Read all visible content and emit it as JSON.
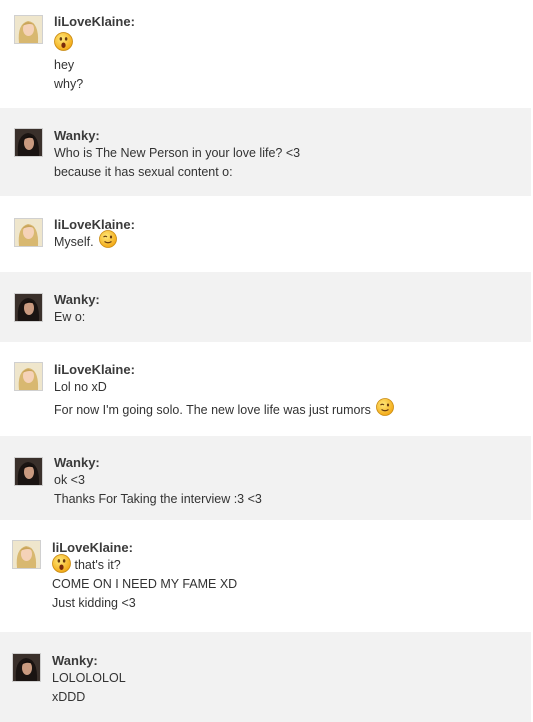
{
  "users": {
    "a": {
      "name": "liLoveKlaine:",
      "avatar_icon": "blonde-avatar-icon"
    },
    "b": {
      "name": "Wanky:",
      "avatar_icon": "dark-hair-avatar-icon"
    }
  },
  "colors": {
    "alt_background": "#f2f2f2",
    "text": "#333333"
  },
  "messages": [
    {
      "author": "liLoveKlaine:",
      "lines": [
        "",
        "hey",
        "why?"
      ],
      "emoji": [
        "shocked-emoji-icon"
      ]
    },
    {
      "author": "Wanky:",
      "lines": [
        "Who is The New Person in your love life? <3",
        "because it has sexual content o:"
      ]
    },
    {
      "author": "liLoveKlaine:",
      "lines": [
        "Myself."
      ],
      "emoji": [
        "wink-emoji-icon"
      ]
    },
    {
      "author": "Wanky:",
      "lines": [
        "Ew o:"
      ]
    },
    {
      "author": "liLoveKlaine:",
      "lines": [
        "Lol no xD",
        "For now I'm going solo. The new love life was just rumors"
      ],
      "emoji": [
        "wink-emoji-icon"
      ]
    },
    {
      "author": "Wanky:",
      "lines": [
        "ok <3",
        "Thanks For Taking the interview :3 <3"
      ]
    },
    {
      "author": "liLoveKlaine:",
      "lines": [
        "that's it?",
        "COME ON I NEED MY FAME XD",
        "Just kidding <3"
      ],
      "emoji": [
        "shocked-emoji-icon"
      ]
    },
    {
      "author": "Wanky:",
      "lines": [
        "LOLOLOLOL",
        "xDDD"
      ]
    }
  ]
}
